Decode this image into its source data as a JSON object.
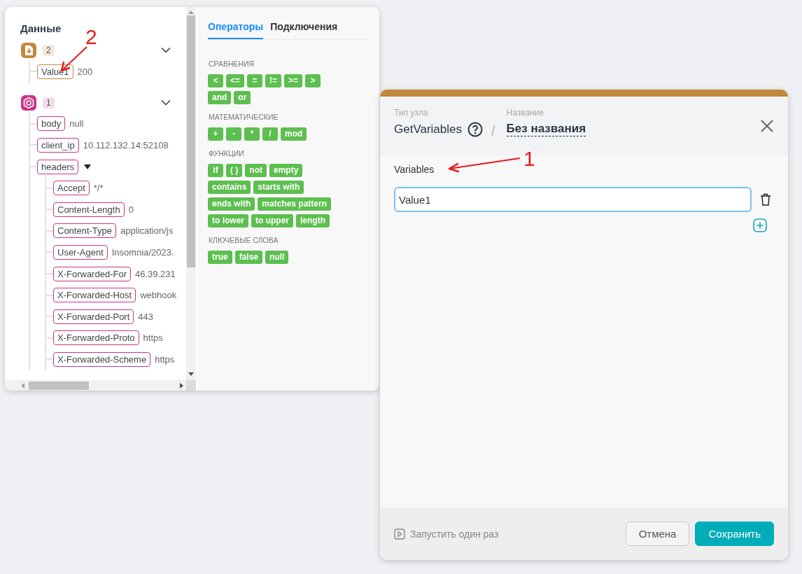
{
  "data_panel": {
    "title": "Данные",
    "groups": [
      {
        "kind": "file",
        "count": "2",
        "expanded": true,
        "children": [
          {
            "key": "Value1",
            "value": "200"
          }
        ]
      },
      {
        "kind": "hook",
        "count": "1",
        "expanded": true,
        "children": [
          {
            "key": "body",
            "value": "null"
          },
          {
            "key": "client_ip",
            "value": "10.112.132.14:52108"
          },
          {
            "key": "headers",
            "expanded": true,
            "children": [
              {
                "key": "Accept",
                "value": "*/*"
              },
              {
                "key": "Content-Length",
                "value": "0"
              },
              {
                "key": "Content-Type",
                "value": "application/js"
              },
              {
                "key": "User-Agent",
                "value": "Insomnia/2023."
              },
              {
                "key": "X-Forwarded-For",
                "value": "46.39.231"
              },
              {
                "key": "X-Forwarded-Host",
                "value": "webhook"
              },
              {
                "key": "X-Forwarded-Port",
                "value": "443"
              },
              {
                "key": "X-Forwarded-Proto",
                "value": "https"
              },
              {
                "key": "X-Forwarded-Scheme",
                "value": "https"
              }
            ]
          }
        ]
      }
    ]
  },
  "operators_panel": {
    "tabs": [
      {
        "label": "Операторы",
        "selected": true
      },
      {
        "label": "Подключения",
        "selected": false
      }
    ],
    "sections": [
      {
        "title": "СРАВНЕНИЯ",
        "items": [
          "<",
          "<=",
          "=",
          "!=",
          ">=",
          ">",
          "and",
          "or"
        ]
      },
      {
        "title": "МАТЕМАТИЧЕСКИЕ",
        "items": [
          "+",
          "-",
          "*",
          "/",
          "mod"
        ]
      },
      {
        "title": "ФУНКЦИИ",
        "items": [
          "if",
          "( )",
          "not",
          "empty",
          "contains",
          "starts with",
          "ends with",
          "matches pattern",
          "to lower",
          "to upper",
          "length"
        ]
      },
      {
        "title": "КЛЮЧЕВЫЕ СЛОВА",
        "items": [
          "true",
          "false",
          "null"
        ]
      }
    ]
  },
  "node_editor": {
    "node_type_label": "Тип узла",
    "node_type": "GetVariables",
    "separator": "/",
    "name_label": "Название",
    "name": "Без названия",
    "field_label": "Variables",
    "variables": [
      {
        "value": "Value1"
      }
    ],
    "run_once": "Запустить один раз",
    "buttons": [
      {
        "kind": "secondary",
        "label": "Отмена"
      },
      {
        "kind": "primary",
        "label": "Сохранить"
      }
    ]
  },
  "annotations": [
    {
      "label": "1"
    },
    {
      "label": "2"
    }
  ]
}
